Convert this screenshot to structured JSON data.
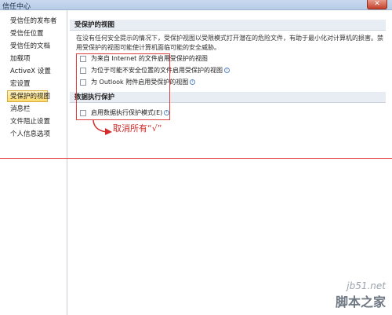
{
  "window": {
    "title": "信任中心",
    "close_icon": "close-icon"
  },
  "sidebar": {
    "items": [
      {
        "label": "受信任的发布者",
        "selected": false
      },
      {
        "label": "受信任位置",
        "selected": false
      },
      {
        "label": "受信任的文档",
        "selected": false
      },
      {
        "label": "加载项",
        "selected": false
      },
      {
        "label": "ActiveX 设置",
        "selected": false
      },
      {
        "label": "宏设置",
        "selected": false
      },
      {
        "label": "受保护的视图",
        "selected": true
      },
      {
        "label": "消息栏",
        "selected": false
      },
      {
        "label": "文件阻止设置",
        "selected": false
      },
      {
        "label": "个人信息选项",
        "selected": false
      }
    ]
  },
  "protected_view": {
    "header": "受保护的视图",
    "description": "在没有任何安全提示的情况下，受保护视图以受限模式打开潜在的危险文件，有助于最小化对计算机的损害。禁用受保护的视图可能使计算机面临可能的安全威胁。",
    "options": [
      {
        "label": "为来自 Internet 的文件启用受保护的视图",
        "checked": false,
        "info": false
      },
      {
        "label": "为位于可能不安全位置的文件启用受保护的视图",
        "checked": false,
        "info": true
      },
      {
        "label": "为 Outlook 附件启用受保护的视图",
        "checked": false,
        "info": true
      }
    ]
  },
  "data_execution": {
    "header": "数据执行保护",
    "option": {
      "label": "启用数据执行保护模式(E)",
      "checked": false,
      "info": true
    }
  },
  "annotation": {
    "text": "取消所有“√”",
    "color": "#d32b2b"
  },
  "watermark": {
    "domain": "jb51.net",
    "name": "脚本之家"
  },
  "colors": {
    "highlight": "#e04040",
    "selected_bg": "#fbd96c"
  }
}
